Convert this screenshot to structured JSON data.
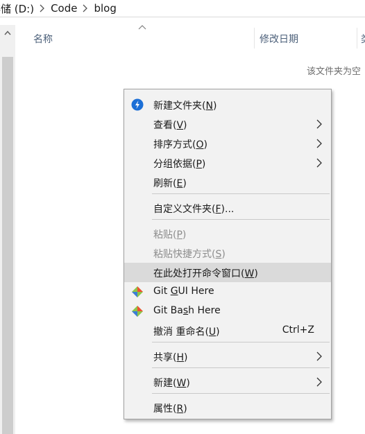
{
  "address_bar": {
    "drive": "存储 (D:)",
    "folder": "Code",
    "subfolder": "blog"
  },
  "columns": {
    "name": "名称",
    "date_modified": "修改日期",
    "more": "类"
  },
  "empty_message": "该文件夹为空",
  "context_menu": {
    "new_folder": {
      "label": "新建文件夹(",
      "key": "N",
      "tail": ")"
    },
    "view": {
      "label": "查看(",
      "key": "V",
      "tail": ")"
    },
    "sort_by": {
      "label": "排序方式(",
      "key": "O",
      "tail": ")"
    },
    "group_by": {
      "label": "分组依据(",
      "key": "P",
      "tail": ")"
    },
    "refresh": {
      "label": "刷新(",
      "key": "E",
      "tail": ")"
    },
    "customize_folder": {
      "label": "自定义文件夹(",
      "key": "F",
      "tail": ")..."
    },
    "paste": {
      "label": "粘贴(",
      "key": "P",
      "tail": ")"
    },
    "paste_shortcut": {
      "label": "粘贴快捷方式(",
      "key": "S",
      "tail": ")"
    },
    "open_cmd": {
      "label": "在此处打开命令窗口(",
      "key": "W",
      "tail": ")"
    },
    "git_gui": {
      "label": "Git ",
      "key": "G",
      "tail": "UI Here"
    },
    "git_bash": {
      "label": "Git Ba",
      "key": "s",
      "tail": "h Here"
    },
    "undo_rename": {
      "label": "撤消 重命名(",
      "key": "U",
      "tail": ")",
      "shortcut": "Ctrl+Z"
    },
    "share": {
      "label": "共享(",
      "key": "H",
      "tail": ")"
    },
    "new": {
      "label": "新建(",
      "key": "W",
      "tail": ")"
    },
    "properties": {
      "label": "属性(",
      "key": "R",
      "tail": ")"
    }
  },
  "colors": {
    "menu_bg": "#f2f2f2",
    "highlight": "#dadada",
    "header_text": "#4c607a",
    "disabled_text": "#8c8c8c"
  }
}
